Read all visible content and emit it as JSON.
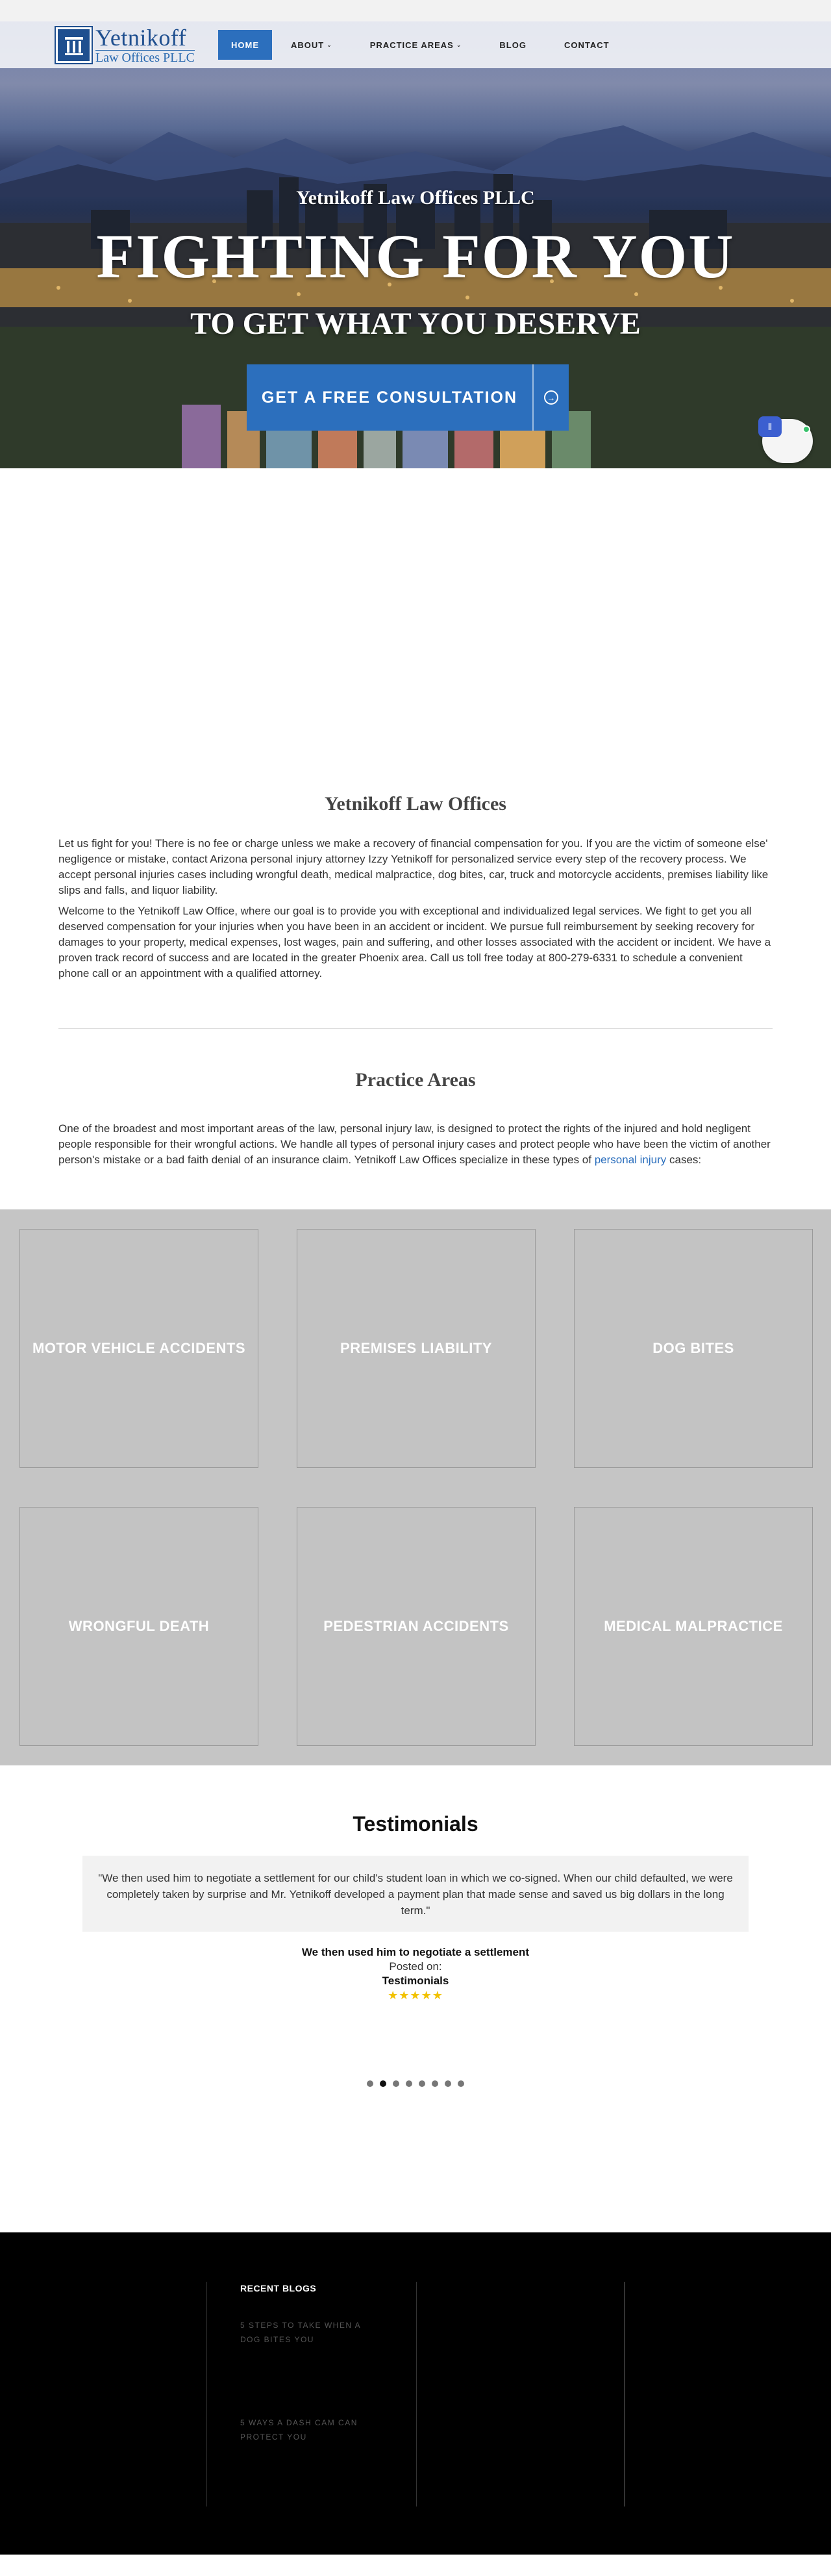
{
  "brand": {
    "name": "Yetnikoff",
    "sub": "Law Offices PLLC",
    "colors": {
      "primary": "#2c6fbd",
      "gray_panel": "#c5c5c5",
      "footer": "#000000",
      "stars": "#f2c200"
    }
  },
  "nav": {
    "home": "HOME",
    "about": "ABOUT",
    "practice": "PRACTICE AREAS",
    "blog": "BLOG",
    "contact": "CONTACT",
    "chevron": "⌄"
  },
  "hero": {
    "firm": "Yetnikoff Law Offices PLLC",
    "title": "FIGHTING FOR YOU",
    "tagline": "TO GET WHAT YOU DESERVE",
    "cta": "GET A FREE CONSULTATION",
    "cta_icon": "arrow-circle-icon"
  },
  "about": {
    "title": "Yetnikoff Law Offices",
    "p1": "Let us fight for you! There is no fee or charge unless we make a recovery of financial compensation for you. If you are the victim of someone else' negligence or mistake, contact Arizona personal injury attorney Izzy Yetnikoff for personalized service every step of the recovery process. We accept personal injuries cases including wrongful death, medical malpractice, dog bites, car, truck and motorcycle accidents, premises liability like slips and falls, and liquor liability.",
    "p2": "Welcome to the Yetnikoff Law Office, where our goal is to provide you with exceptional and individualized legal services. We fight to get you all deserved compensation for your injuries when you have been in an accident or incident. We pursue full reimbursement by seeking recovery for damages to your property, medical expenses, lost wages, pain and suffering, and other losses associated with the accident or incident. We have a proven track record of success and are located in the greater Phoenix area. Call us toll free today at 800-279-6331 to schedule a convenient phone call or an appointment with a qualified attorney."
  },
  "practice": {
    "title": "Practice Areas",
    "text_before": "One of the broadest and most important areas of the law, personal injury law, is designed to protect the rights of the injured and hold negligent people responsible for their wrongful actions. We handle all types of personal injury cases and protect people who have been the victim of another person's mistake or a bad faith denial of an insurance claim. Yetnikoff Law Offices specialize in these types of",
    "link": "personal injury",
    "text_after": "cases:",
    "areas": [
      "MOTOR VEHICLE ACCIDENTS",
      "PREMISES LIABILITY",
      "DOG BITES",
      "WRONGFUL DEATH",
      "PEDESTRIAN ACCIDENTS",
      "MEDICAL MALPRACTICE"
    ]
  },
  "testimonials": {
    "title": "Testimonials",
    "quote": "\"We then used him to negotiate a settlement for our child's student loan in which we co-signed.  When our child defaulted, we were completely taken by surprise and Mr. Yetnikoff developed a payment plan that made sense and saved us big dollars in the long term.\"",
    "item_title": "We then used him to negotiate a settlement",
    "posted": "Posted on:",
    "category": "Testimonials",
    "stars": "★★★★★",
    "rating": 5,
    "slides": 8,
    "active_slide": 2
  },
  "footer": {
    "recent_title": "RECENT BLOGS",
    "blogs": [
      "5 STEPS TO TAKE WHEN A DOG BITES YOU",
      "5 WAYS A DASH CAM CAN PROTECT YOU"
    ]
  }
}
